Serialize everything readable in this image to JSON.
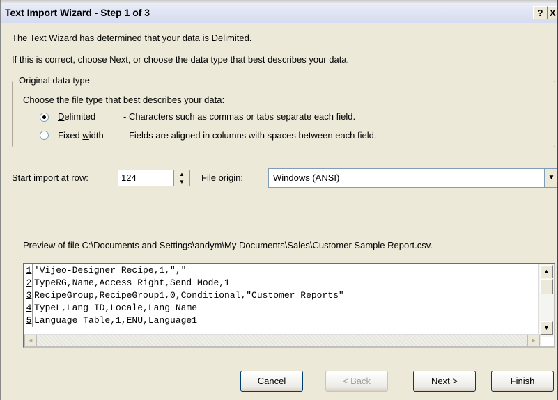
{
  "window": {
    "title": "Text Import Wizard - Step 1 of 3",
    "help_label": "?",
    "close_label": "X"
  },
  "intro": {
    "line1": "The Text Wizard has determined that your data is Delimited.",
    "line2": "If this is correct, choose Next, or choose the data type that best describes your data."
  },
  "data_type": {
    "group_label": "Original data type",
    "prompt": "Choose the file type that best describes your data:",
    "options": [
      {
        "label_accel": "D",
        "label_rest": "elimited",
        "description": "- Characters such as commas or tabs separate each field.",
        "selected": true
      },
      {
        "label_pre": "Fixed ",
        "label_accel": "w",
        "label_rest": "idth",
        "description": "- Fields are aligned in columns with spaces between each field.",
        "selected": false
      }
    ]
  },
  "start_row": {
    "label_pre": "Start import at ",
    "label_accel": "r",
    "label_rest": "ow:",
    "value": "124"
  },
  "file_origin": {
    "label_pre": "File ",
    "label_accel": "o",
    "label_rest": "rigin:",
    "value": "Windows (ANSI)"
  },
  "preview": {
    "label": "Preview of file C:\\Documents and Settings\\andym\\My Documents\\Sales\\Customer Sample Report.csv.",
    "lines": [
      {
        "num": "1",
        "text": "'Vijeo-Designer Recipe,1,\",\""
      },
      {
        "num": "2",
        "text": "TypeRG,Name,Access Right,Send Mode,1"
      },
      {
        "num": "3",
        "text": "RecipeGroup,RecipeGroup1,0,Conditional,\"Customer Reports\""
      },
      {
        "num": "4",
        "text": "TypeL,Lang ID,Locale,Lang Name"
      },
      {
        "num": "5",
        "text": "Language Table,1,ENU,Language1"
      }
    ]
  },
  "buttons": {
    "cancel": "Cancel",
    "back": "< Back",
    "next_accel": "N",
    "next_rest": "ext >",
    "finish_accel": "F",
    "finish_rest": "inish"
  },
  "icons": {
    "spin_up": "▲",
    "spin_down": "▼",
    "dropdown": "▼",
    "scroll_up": "▲",
    "scroll_down": "▼",
    "scroll_left": "◄",
    "scroll_right": "►"
  }
}
